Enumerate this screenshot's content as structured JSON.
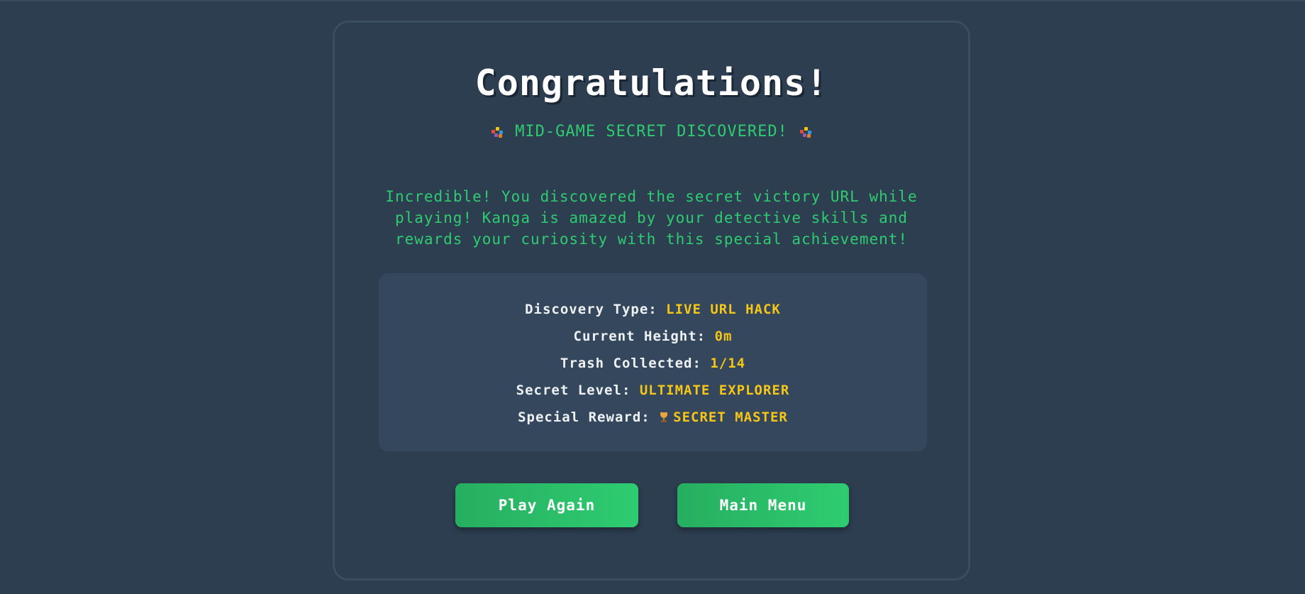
{
  "title": "Congratulations!",
  "subtitle": "MID-GAME SECRET DISCOVERED!",
  "message": "Incredible! You discovered the secret victory URL while playing! Kanga is amazed by your detective skills and rewards your curiosity with this special achievement!",
  "stats": [
    {
      "label": "Discovery Type:",
      "value": "LIVE URL HACK"
    },
    {
      "label": "Current Height:",
      "value": "0m"
    },
    {
      "label": "Trash Collected:",
      "value": "1/14"
    },
    {
      "label": "Secret Level:",
      "value": "ULTIMATE EXPLORER"
    },
    {
      "label": "Special Reward:",
      "value": "SECRET MASTER",
      "icon": "trophy-icon"
    }
  ],
  "buttons": {
    "play_again": "Play Again",
    "main_menu": "Main Menu"
  },
  "colors": {
    "background": "#2d3e50",
    "accent_green": "#2ecc71",
    "value_gold": "#f5c518",
    "panel": "#35475c"
  },
  "icons": [
    "confetti-icon",
    "trophy-icon"
  ]
}
